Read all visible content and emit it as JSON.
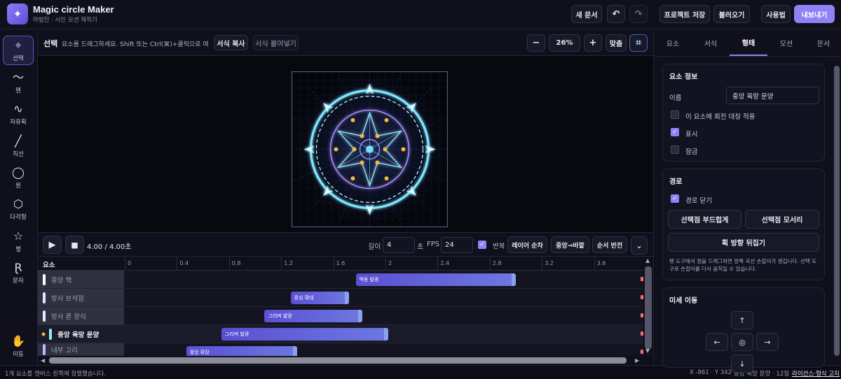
{
  "header": {
    "title": "Magic circle Maker",
    "subtitle": "마법진 · 시인 모션 제작기",
    "new_doc": "새 문서",
    "undo": "↶",
    "redo": "↷",
    "save_project": "프로젝트 저장",
    "load": "불러오기",
    "usage": "사용법",
    "export": "내보내기"
  },
  "tools": [
    {
      "label": "선택",
      "icon": "⌖"
    },
    {
      "label": "펜",
      "icon": "〜"
    },
    {
      "label": "자유획",
      "icon": "∿"
    },
    {
      "label": "직선",
      "icon": "╱"
    },
    {
      "label": "원",
      "icon": "◯"
    },
    {
      "label": "다각형",
      "icon": "⬡"
    },
    {
      "label": "별",
      "icon": "☆"
    },
    {
      "label": "문자",
      "icon": "Ɽ"
    },
    {
      "label": "이동",
      "icon": "✋"
    }
  ],
  "canvas": {
    "mode": "선택",
    "hint": "요소를 드래그하세요. Shift 또는 Ctrl(⌘)+클릭으로 여...",
    "copy_style": "서식 복사",
    "paste_style": "서식 붙여넣기",
    "zoom_out": "−",
    "zoom": "26%",
    "zoom_in": "+",
    "fit": "맞춤",
    "frame_icon": "⌗"
  },
  "playback": {
    "time": "4.00 / 4.00초",
    "length_label": "길이",
    "length": "4",
    "seconds_label": "초",
    "fps_label": "FPS",
    "fps": "24",
    "loop_label": "반복",
    "layer_order": "레이어 순차",
    "center_out": "중앙→바깥",
    "reverse": "순서 반전",
    "more": "⌄"
  },
  "timeline": {
    "header": "요소",
    "ticks": [
      "0",
      "0.4",
      "0.8",
      "1.2",
      "1.6",
      "2",
      "2.4",
      "2.8",
      "3.2",
      "3.6"
    ],
    "layers": [
      {
        "name": "중앙 핵",
        "color": "#ffffff",
        "bar": "맥동 발광",
        "start": 1.75,
        "end": 2.98
      },
      {
        "name": "방사 보석점",
        "color": "#dfe8ff",
        "bar": "중심 확대",
        "start": 1.25,
        "end": 1.7
      },
      {
        "name": "방사 룬 장식",
        "color": "#e6e9ff",
        "bar": "그리며 발광",
        "start": 1.05,
        "end": 1.8
      },
      {
        "name": "중앙 육망 문양",
        "color": "#9ce8ff",
        "bar": "그리며 발광",
        "start": 0.72,
        "end": 2.0
      },
      {
        "name": "내부 고리",
        "color": "#c4b5fd",
        "bar": "중앙 확장",
        "start": 0.45,
        "end": 1.3
      }
    ]
  },
  "status": {
    "left": "1개 요소를 캔버스 왼쪽에 정렬했습니다.",
    "coords": "X -861 · Y 342",
    "element": "중앙 육망 문양 · 12점",
    "license": "라이선스·형식 고지"
  },
  "panel": {
    "tabs": [
      "요소",
      "서식",
      "형태",
      "모션",
      "문서"
    ],
    "info_title": "요소 정보",
    "name_label": "이름",
    "name_value": "중앙 육망 문양",
    "rot_sym": "이 요소에 회전 대칭 적용",
    "show": "표시",
    "lock": "잠금",
    "path_title": "경로",
    "close_path": "경로 닫기",
    "smooth": "선택점 부드럽게",
    "corner": "선택점 모서리",
    "flip": "획 방향 뒤집기",
    "path_help": "펜 도구에서 점을 드래그하면 양쪽 곡선 손잡이가 생깁니다. 선택 도구로 손잡이를 다시 움직일 수 있습니다.",
    "nudge_title": "미세 이동",
    "nudge": {
      "up": "↑",
      "left": "←",
      "center": "◎",
      "right": "→",
      "down": "↓"
    }
  },
  "colors": {
    "accent": "#8f82f7",
    "bg": "#0e0f1a",
    "glow": "#7fe6ff",
    "violet": "#a78bfa",
    "dot": "#f5b942"
  }
}
